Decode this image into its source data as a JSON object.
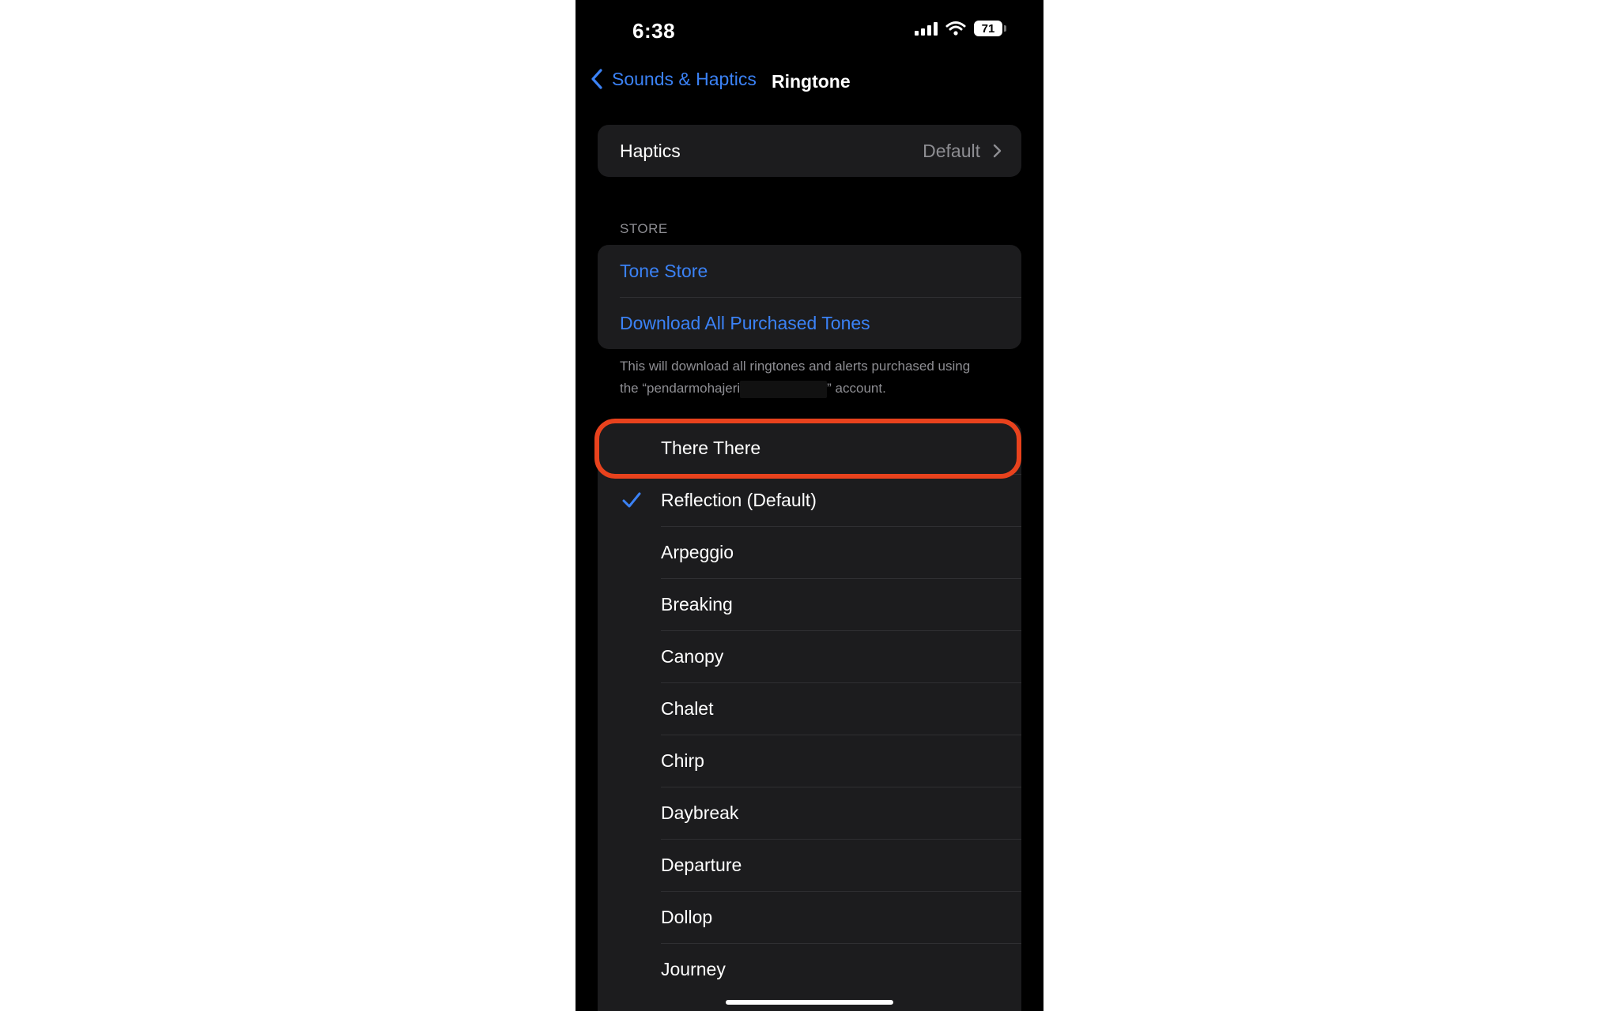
{
  "status_bar": {
    "time": "6:38",
    "battery": "71"
  },
  "nav": {
    "back_label": "Sounds & Haptics",
    "title": "Ringtone"
  },
  "haptics": {
    "label": "Haptics",
    "value": "Default"
  },
  "store": {
    "header": "STORE",
    "items": [
      "Tone Store",
      "Download All Purchased Tones"
    ],
    "footnote_pre": "This will download all ringtones and alerts purchased using the “pendarmohajeri",
    "footnote_post": "” account."
  },
  "tones": {
    "selected": "Reflection (Default)",
    "items": [
      "There There",
      "Reflection (Default)",
      "Arpeggio",
      "Breaking",
      "Canopy",
      "Chalet",
      "Chirp",
      "Daybreak",
      "Departure",
      "Dollop",
      "Journey"
    ]
  },
  "colors": {
    "accent": "#3b82f6",
    "highlight": "#e8421d",
    "cell": "#1c1c1e"
  }
}
